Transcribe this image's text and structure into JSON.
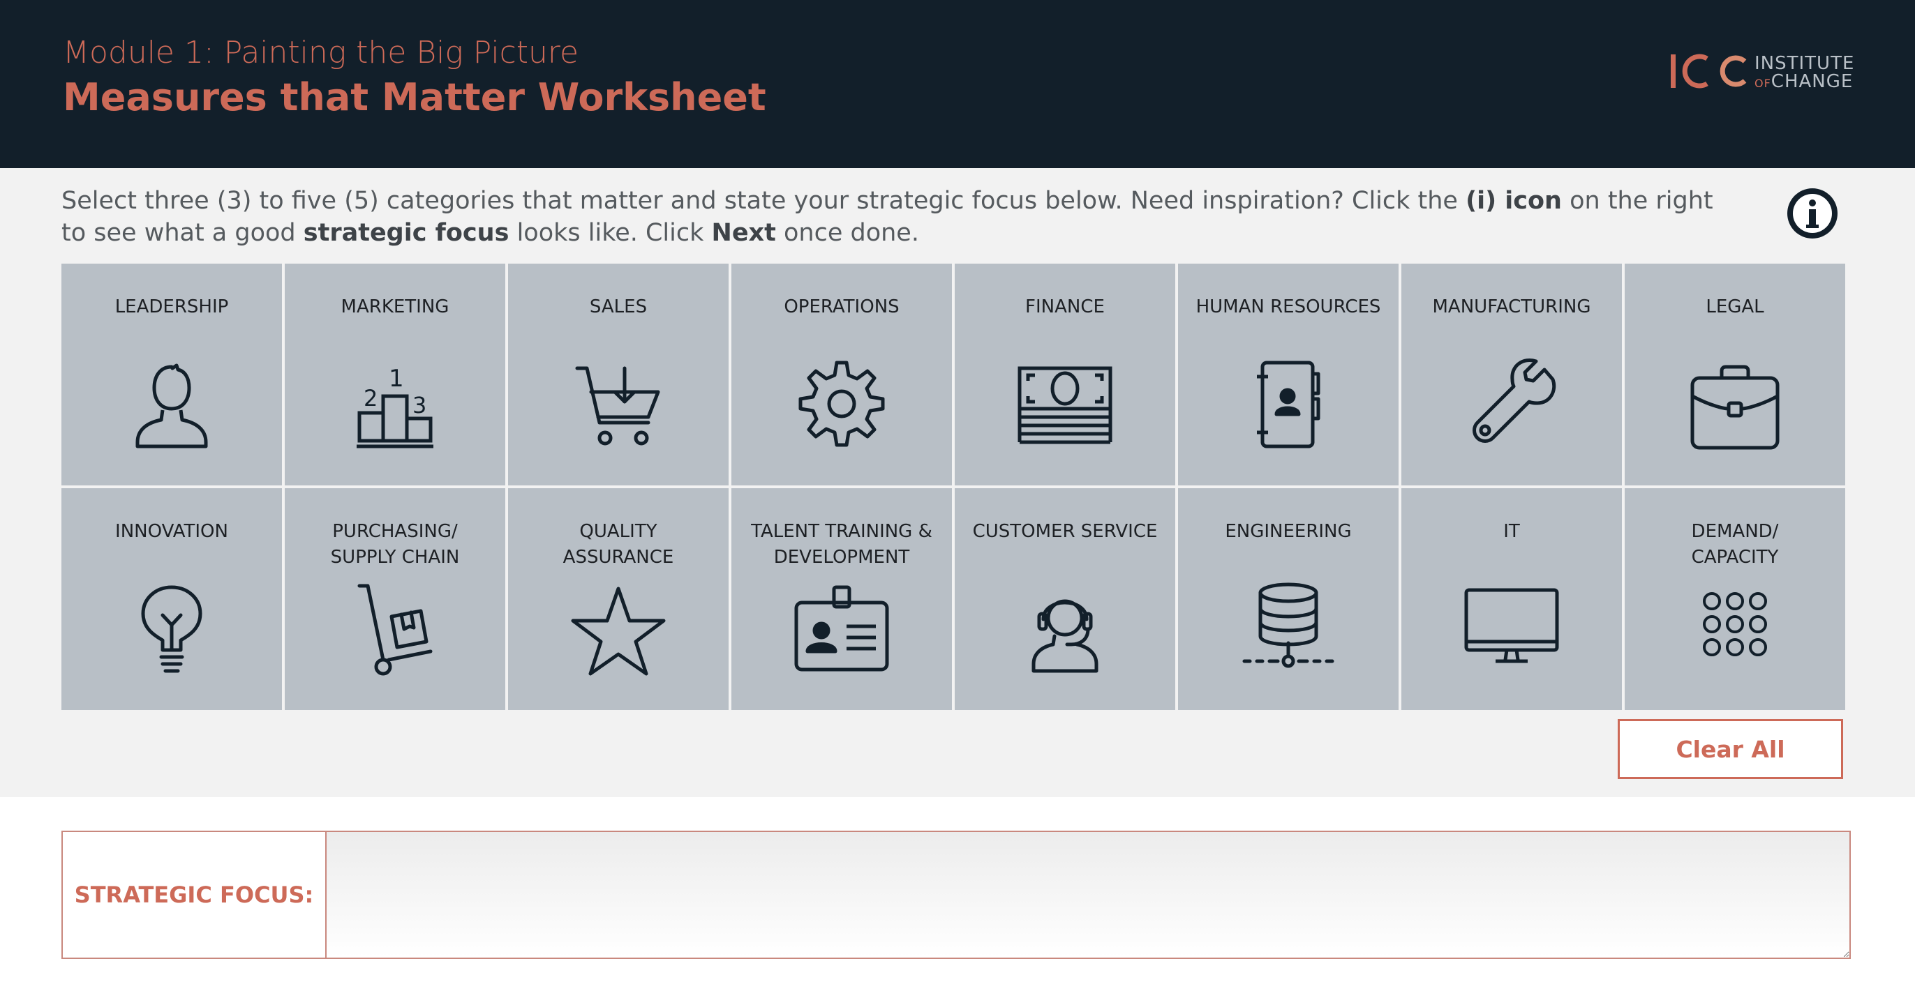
{
  "header": {
    "module_title": "Module 1: Painting the Big Picture",
    "worksheet_title": "Measures that Matter Worksheet",
    "logo": {
      "mark": "IOC",
      "line1": "INSTITUTE",
      "line2_small": "OF",
      "line2": "CHANGE"
    }
  },
  "instructions": {
    "part1": "Select three (3) to five (5) categories that matter and state your strategic focus below. Need inspiration? Click the ",
    "bold1": "(i) icon",
    "part2": " on the right to see what a good ",
    "bold2": "strategic focus",
    "part3": " looks like. Click ",
    "bold3": "Next",
    "part4": " once done."
  },
  "categories": [
    {
      "label": "LEADERSHIP",
      "icon": "person-icon"
    },
    {
      "label": "MARKETING",
      "icon": "podium-icon"
    },
    {
      "label": "SALES",
      "icon": "cart-icon"
    },
    {
      "label": "OPERATIONS",
      "icon": "gear-icon"
    },
    {
      "label": "FINANCE",
      "icon": "money-icon"
    },
    {
      "label": "HUMAN RESOURCES",
      "icon": "contact-book-icon"
    },
    {
      "label": "MANUFACTURING",
      "icon": "wrench-icon"
    },
    {
      "label": "LEGAL",
      "icon": "briefcase-icon"
    },
    {
      "label": "INNOVATION",
      "icon": "lightbulb-icon"
    },
    {
      "label": "PURCHASING/\nSUPPLY CHAIN",
      "icon": "hand-truck-icon"
    },
    {
      "label": "QUALITY\nASSURANCE",
      "icon": "star-icon"
    },
    {
      "label": "TALENT TRAINING &\nDEVELOPMENT",
      "icon": "id-badge-icon"
    },
    {
      "label": "CUSTOMER SERVICE",
      "icon": "headset-icon"
    },
    {
      "label": "ENGINEERING",
      "icon": "database-icon"
    },
    {
      "label": "IT",
      "icon": "monitor-icon"
    },
    {
      "label": "DEMAND/\nCAPACITY",
      "icon": "dot-grid-icon"
    }
  ],
  "clear_all_label": "Clear All",
  "strategic_focus": {
    "label": "STRATEGIC FOCUS:",
    "value": ""
  },
  "colors": {
    "header_bg": "#121f2a",
    "accent": "#cd6a58",
    "tile_bg": "#b8bfc6",
    "panel_bg": "#f2f2f2"
  }
}
